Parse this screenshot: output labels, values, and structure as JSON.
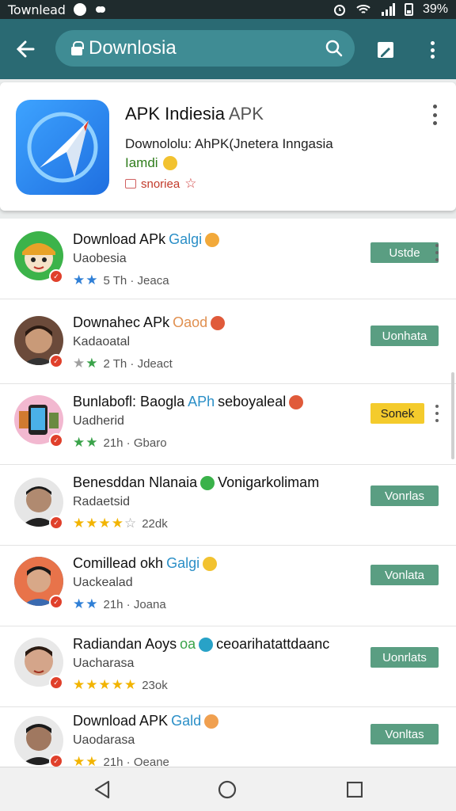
{
  "status_bar": {
    "title": "Townlead",
    "right_text": "39%"
  },
  "app_bar": {
    "search_query": "Downlosia"
  },
  "featured": {
    "title": "APK Indiesia",
    "title_suffix": "APK",
    "subtitle": "Downololu: AhPK(Jnetera Inngasia",
    "subtitle2": "Iamdi",
    "meta": "snoriea"
  },
  "list": [
    {
      "title": "Download APk",
      "tag": "Galgi",
      "sub": "Uaobesia",
      "rating": 2,
      "rating_color": "blue",
      "meta": "5 Th · Jeaca",
      "action": "Ustde",
      "action_style": "green",
      "avatar_color": "#3cb34a"
    },
    {
      "title": "Downahec APk",
      "tag": "Oaod",
      "sub": "Kadaoatal",
      "rating": 2,
      "rating_color": "green",
      "meta": "2 Th · Jdeact",
      "action": "Uonhata",
      "action_style": "green",
      "avatar_color": "#6b4a3a"
    },
    {
      "title": "Bunlabofl: Baogla",
      "tag": "APh",
      "tag2": "seboyaleal",
      "sub": "Uadherid",
      "rating": 2,
      "rating_color": "green",
      "meta": "21h · Gbaro",
      "action": "Sonek",
      "action_style": "yellow",
      "avatar_color": "#f2b8d0"
    },
    {
      "title": "Benesddan Nlanaia",
      "tag": "Vonigarkolimam",
      "sub": "Radaetsid",
      "rating": 4,
      "rating_color": "yellow",
      "meta": "22dk",
      "action": "Vonrlas",
      "action_style": "green",
      "avatar_color": "#b08a70"
    },
    {
      "title": "Comillead okh",
      "tag": "Galgi",
      "sub": "Uackealad",
      "rating": 2,
      "rating_color": "blue",
      "meta": "21h · Joana",
      "action": "Vonlata",
      "action_style": "green",
      "avatar_color": "#2d7bd0"
    },
    {
      "title": "Radiandan Aoys",
      "tag": "oa",
      "tag2": "ceoarihatattdaanc",
      "sub": "Uacharasa",
      "rating": 5,
      "rating_color": "yellow",
      "meta": "23ok",
      "action": "Uonrlats",
      "action_style": "green",
      "avatar_color": "#d4a58a"
    },
    {
      "title": "Download APK",
      "tag": "Gald",
      "sub": "Uaodarasa",
      "rating": 2,
      "rating_color": "yellow",
      "meta": "21h · Oeane",
      "action": "Vonltas",
      "action_style": "green",
      "avatar_color": "#6a5646"
    }
  ]
}
